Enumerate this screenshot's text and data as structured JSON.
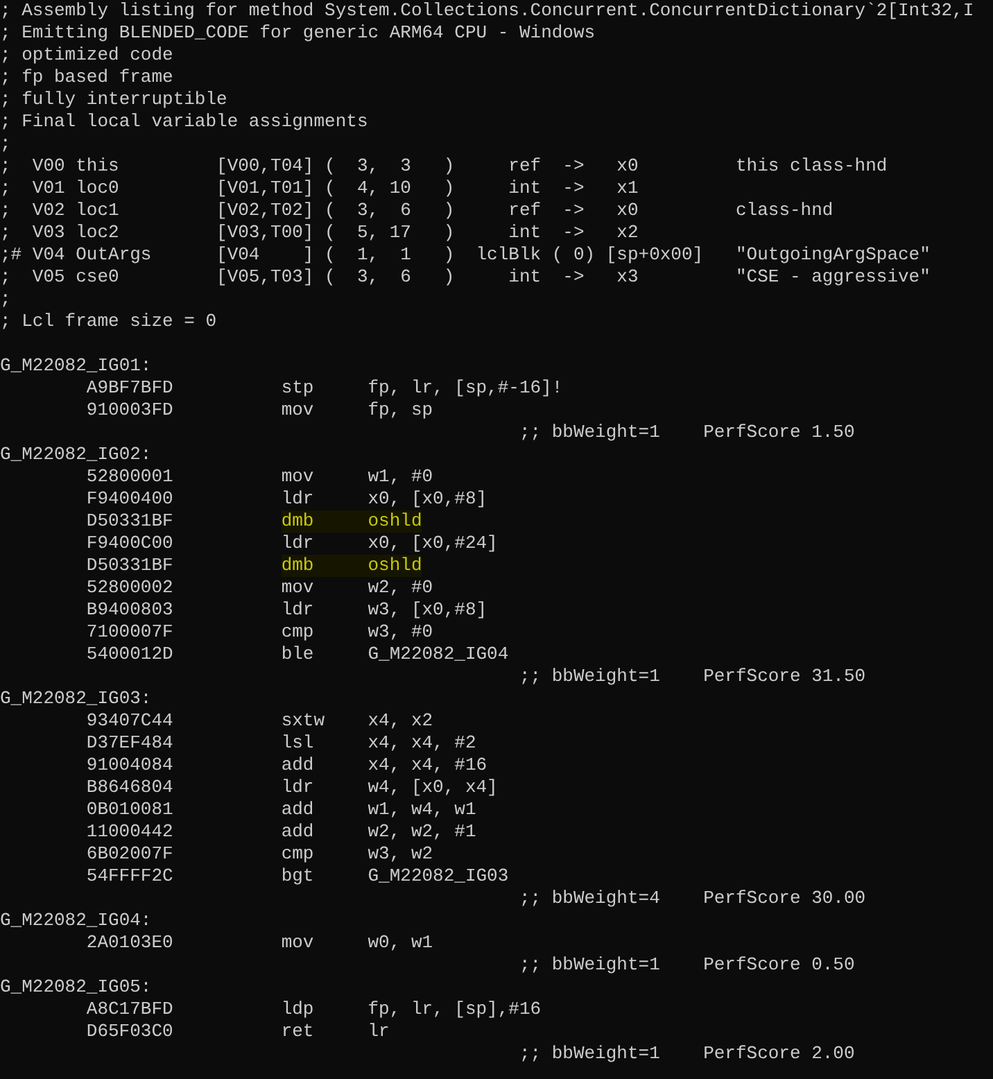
{
  "header_comments": [
    "; Assembly listing for method System.Collections.Concurrent.ConcurrentDictionary`2[Int32,I",
    "; Emitting BLENDED_CODE for generic ARM64 CPU - Windows",
    "; optimized code",
    "; fp based frame",
    "; fully interruptible",
    "; Final local variable assignments",
    ";"
  ],
  "variables": [
    ";  V00 this         [V00,T04] (  3,  3   )     ref  ->   x0         this class-hnd",
    ";  V01 loc0         [V01,T01] (  4, 10   )     int  ->   x1",
    ";  V02 loc1         [V02,T02] (  3,  6   )     ref  ->   x0         class-hnd",
    ";  V03 loc2         [V03,T00] (  5, 17   )     int  ->   x2",
    ";# V04 OutArgs      [V04    ] (  1,  1   )  lclBlk ( 0) [sp+0x00]   \"OutgoingArgSpace\"",
    ";  V05 cse0         [V05,T03] (  3,  6   )     int  ->   x3         \"CSE - aggressive\""
  ],
  "footer_comments": [
    ";",
    "; Lcl frame size = 0"
  ],
  "blocks": [
    {
      "label": "G_M22082_IG01:",
      "instructions": [
        {
          "hex": "A9BF7BFD",
          "op": "stp",
          "operands": "fp, lr, [sp,#-16]!",
          "highlighted": false
        },
        {
          "hex": "910003FD",
          "op": "mov",
          "operands": "fp, sp",
          "highlighted": false
        }
      ],
      "weight": ";; bbWeight=1",
      "perf_score": "PerfScore 1.50"
    },
    {
      "label": "G_M22082_IG02:",
      "instructions": [
        {
          "hex": "52800001",
          "op": "mov",
          "operands": "w1, #0",
          "highlighted": false
        },
        {
          "hex": "F9400400",
          "op": "ldr",
          "operands": "x0, [x0,#8]",
          "highlighted": false
        },
        {
          "hex": "D50331BF",
          "op": "dmb",
          "operands": "oshld",
          "highlighted": true
        },
        {
          "hex": "F9400C00",
          "op": "ldr",
          "operands": "x0, [x0,#24]",
          "highlighted": false
        },
        {
          "hex": "D50331BF",
          "op": "dmb",
          "operands": "oshld",
          "highlighted": true
        },
        {
          "hex": "52800002",
          "op": "mov",
          "operands": "w2, #0",
          "highlighted": false
        },
        {
          "hex": "B9400803",
          "op": "ldr",
          "operands": "w3, [x0,#8]",
          "highlighted": false
        },
        {
          "hex": "7100007F",
          "op": "cmp",
          "operands": "w3, #0",
          "highlighted": false
        },
        {
          "hex": "5400012D",
          "op": "ble",
          "operands": "G_M22082_IG04",
          "highlighted": false
        }
      ],
      "weight": ";; bbWeight=1",
      "perf_score": "PerfScore 31.50"
    },
    {
      "label": "G_M22082_IG03:",
      "instructions": [
        {
          "hex": "93407C44",
          "op": "sxtw",
          "operands": "x4, x2",
          "highlighted": false
        },
        {
          "hex": "D37EF484",
          "op": "lsl",
          "operands": "x4, x4, #2",
          "highlighted": false
        },
        {
          "hex": "91004084",
          "op": "add",
          "operands": "x4, x4, #16",
          "highlighted": false
        },
        {
          "hex": "B8646804",
          "op": "ldr",
          "operands": "w4, [x0, x4]",
          "highlighted": false
        },
        {
          "hex": "0B010081",
          "op": "add",
          "operands": "w1, w4, w1",
          "highlighted": false
        },
        {
          "hex": "11000442",
          "op": "add",
          "operands": "w2, w2, #1",
          "highlighted": false
        },
        {
          "hex": "6B02007F",
          "op": "cmp",
          "operands": "w3, w2",
          "highlighted": false
        },
        {
          "hex": "54FFFF2C",
          "op": "bgt",
          "operands": "G_M22082_IG03",
          "highlighted": false
        }
      ],
      "weight": ";; bbWeight=4",
      "perf_score": "PerfScore 30.00"
    },
    {
      "label": "G_M22082_IG04:",
      "instructions": [
        {
          "hex": "2A0103E0",
          "op": "mov",
          "operands": "w0, w1",
          "highlighted": false
        }
      ],
      "weight": ";; bbWeight=1",
      "perf_score": "PerfScore 0.50"
    },
    {
      "label": "G_M22082_IG05:",
      "instructions": [
        {
          "hex": "A8C17BFD",
          "op": "ldp",
          "operands": "fp, lr, [sp],#16",
          "highlighted": false
        },
        {
          "hex": "D65F03C0",
          "op": "ret",
          "operands": "lr",
          "highlighted": false
        }
      ],
      "weight": ";; bbWeight=1",
      "perf_score": "PerfScore 2.00"
    }
  ]
}
